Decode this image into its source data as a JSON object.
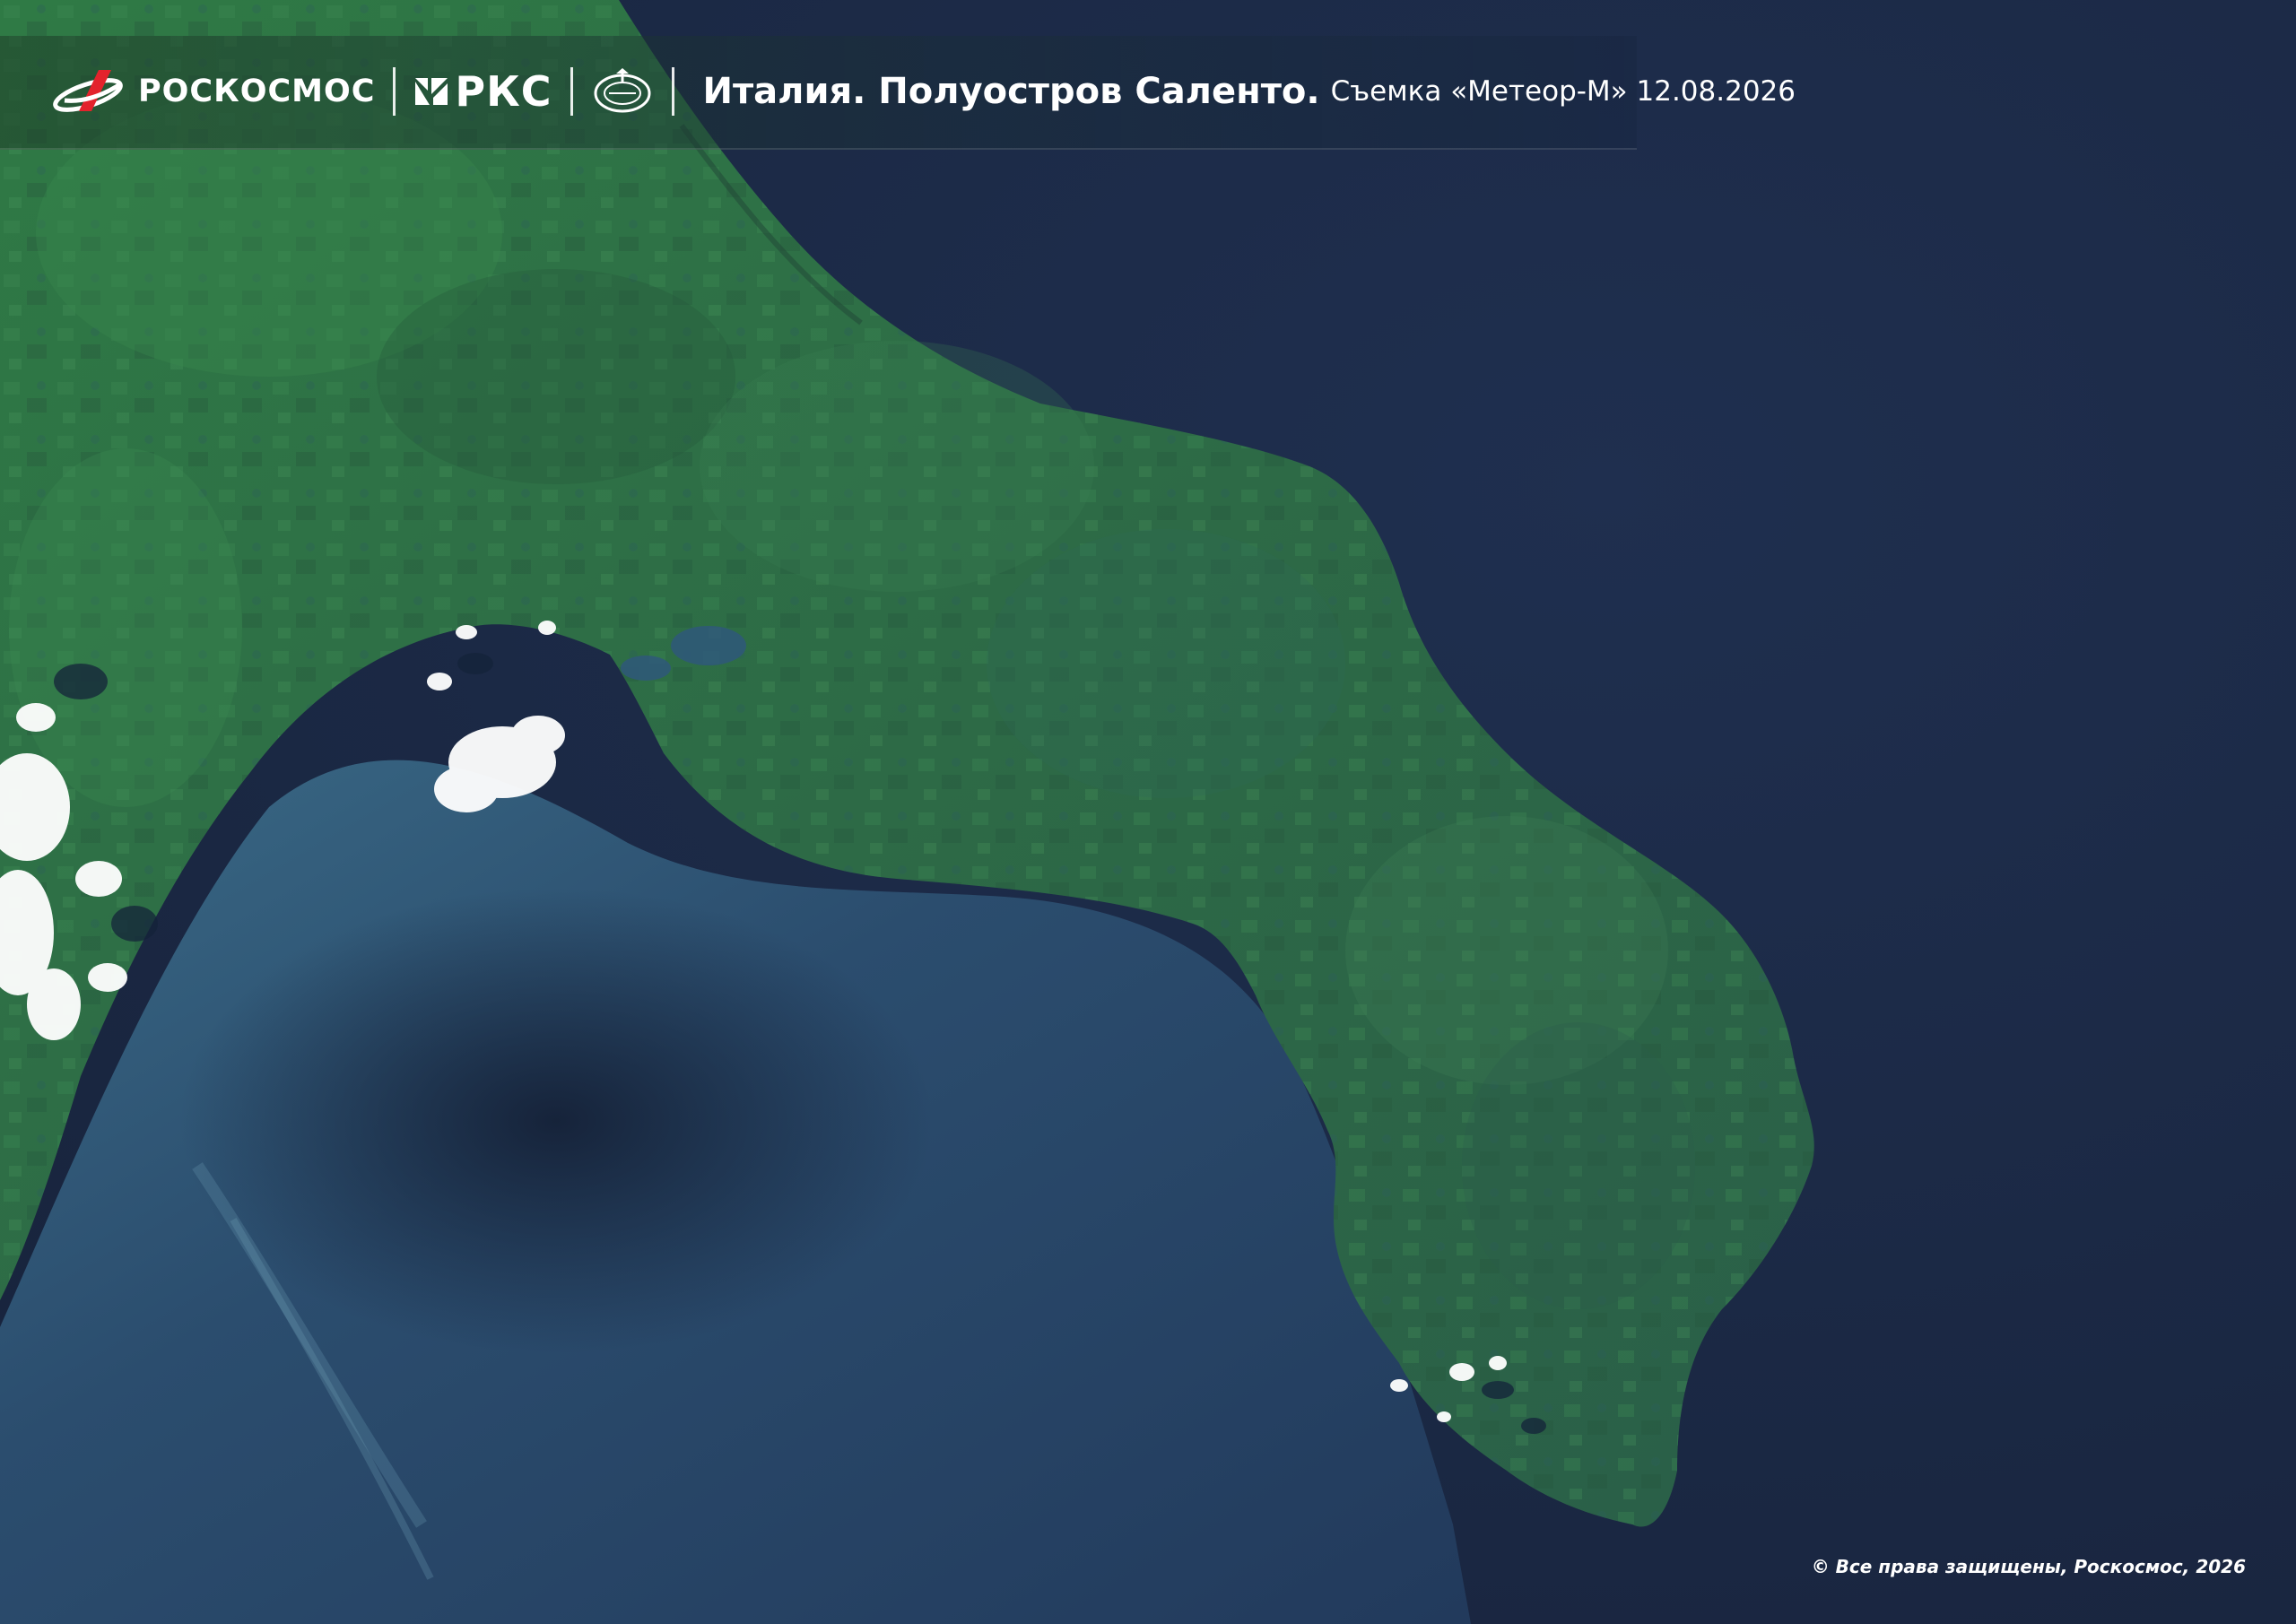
{
  "header": {
    "brand": "РОСКОСМОС",
    "rks": "РКС",
    "title": "Италия. Полуостров Саленто.",
    "subtitle": "Съемка «Метеор-М» 12.08.2026"
  },
  "footer": {
    "copyright": "© Все права защищены, Роскосмос, 2026"
  },
  "colors": {
    "sea": "#1b2a46",
    "land": "#2e6e45",
    "shallow_water": "#2f5c7c",
    "clouds": "#ffffff"
  },
  "icons": [
    "roscosmos-rocket-icon",
    "rks-icon",
    "nc-omz-emblem-icon"
  ]
}
